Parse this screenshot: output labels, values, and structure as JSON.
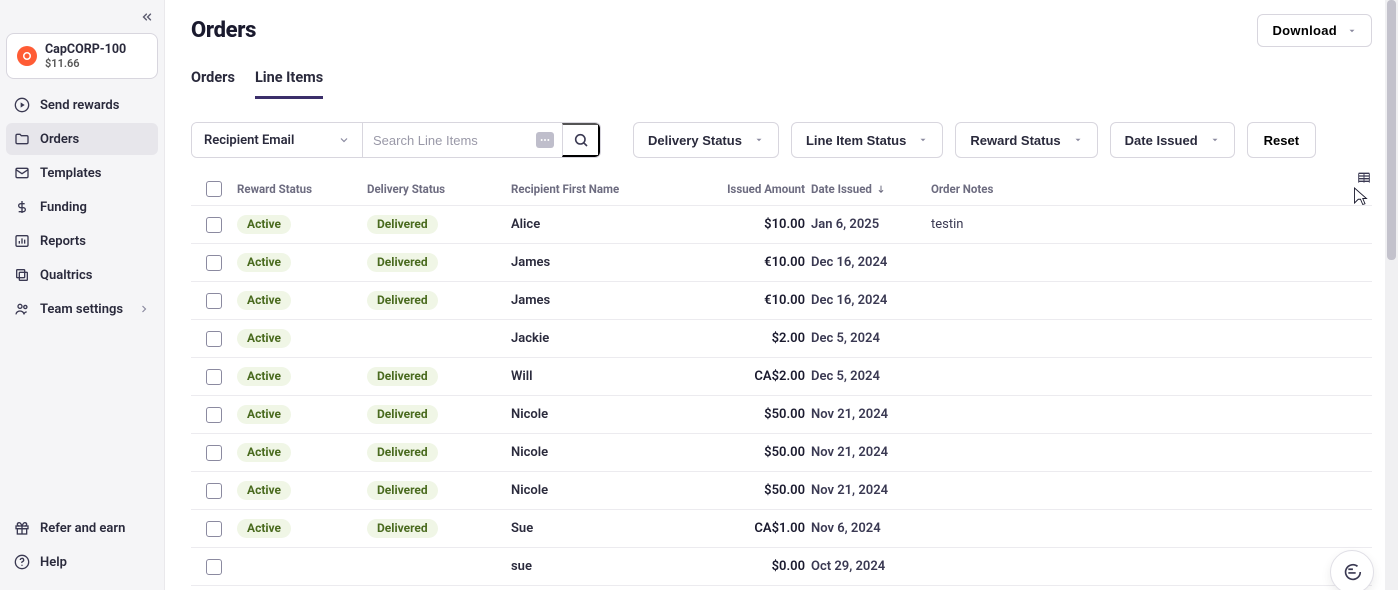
{
  "org": {
    "name": "CapCORP-100",
    "balance": "$11.66"
  },
  "sidebar": {
    "items": [
      {
        "label": "Send rewards",
        "icon": "play-icon"
      },
      {
        "label": "Orders",
        "icon": "folder-icon",
        "active": true
      },
      {
        "label": "Templates",
        "icon": "mail-icon"
      },
      {
        "label": "Funding",
        "icon": "dollar-icon"
      },
      {
        "label": "Reports",
        "icon": "bar-chart-icon"
      },
      {
        "label": "Qualtrics",
        "icon": "stack-icon"
      },
      {
        "label": "Team settings",
        "icon": "users-icon",
        "chevron": true
      }
    ],
    "bottom": [
      {
        "label": "Refer and earn",
        "icon": "gift-icon"
      },
      {
        "label": "Help",
        "icon": "help-icon"
      }
    ]
  },
  "header": {
    "title": "Orders"
  },
  "download": {
    "label": "Download"
  },
  "tabs": [
    {
      "label": "Orders",
      "active": false
    },
    {
      "label": "Line Items",
      "active": true
    }
  ],
  "search": {
    "type_label": "Recipient Email",
    "placeholder": "Search Line Items"
  },
  "filters": [
    {
      "label": "Delivery Status"
    },
    {
      "label": "Line Item Status"
    },
    {
      "label": "Reward Status"
    },
    {
      "label": "Date Issued"
    }
  ],
  "reset": {
    "label": "Reset"
  },
  "table": {
    "columns": {
      "reward_status": "Reward Status",
      "delivery_status": "Delivery Status",
      "recipient_first_name": "Recipient First Name",
      "issued_amount": "Issued Amount",
      "date_issued": "Date Issued",
      "order_notes": "Order Notes"
    },
    "sort": {
      "column": "date_issued",
      "dir": "desc"
    },
    "rows": [
      {
        "reward_status": "Active",
        "delivery_status": "Delivered",
        "name": "Alice",
        "amount": "$10.00",
        "date": "Jan 6, 2025",
        "notes": "testin"
      },
      {
        "reward_status": "Active",
        "delivery_status": "Delivered",
        "name": "James",
        "amount": "€10.00",
        "date": "Dec 16, 2024",
        "notes": ""
      },
      {
        "reward_status": "Active",
        "delivery_status": "Delivered",
        "name": "James",
        "amount": "€10.00",
        "date": "Dec 16, 2024",
        "notes": ""
      },
      {
        "reward_status": "Active",
        "delivery_status": "",
        "name": "Jackie",
        "amount": "$2.00",
        "date": "Dec 5, 2024",
        "notes": ""
      },
      {
        "reward_status": "Active",
        "delivery_status": "Delivered",
        "name": "Will",
        "amount": "CA$2.00",
        "date": "Dec 5, 2024",
        "notes": ""
      },
      {
        "reward_status": "Active",
        "delivery_status": "Delivered",
        "name": "Nicole",
        "amount": "$50.00",
        "date": "Nov 21, 2024",
        "notes": ""
      },
      {
        "reward_status": "Active",
        "delivery_status": "Delivered",
        "name": "Nicole",
        "amount": "$50.00",
        "date": "Nov 21, 2024",
        "notes": ""
      },
      {
        "reward_status": "Active",
        "delivery_status": "Delivered",
        "name": "Nicole",
        "amount": "$50.00",
        "date": "Nov 21, 2024",
        "notes": ""
      },
      {
        "reward_status": "Active",
        "delivery_status": "Delivered",
        "name": "Sue",
        "amount": "CA$1.00",
        "date": "Nov 6, 2024",
        "notes": ""
      },
      {
        "reward_status": "",
        "delivery_status": "",
        "name": "sue",
        "amount": "$0.00",
        "date": "Oct 29, 2024",
        "notes": ""
      }
    ]
  }
}
